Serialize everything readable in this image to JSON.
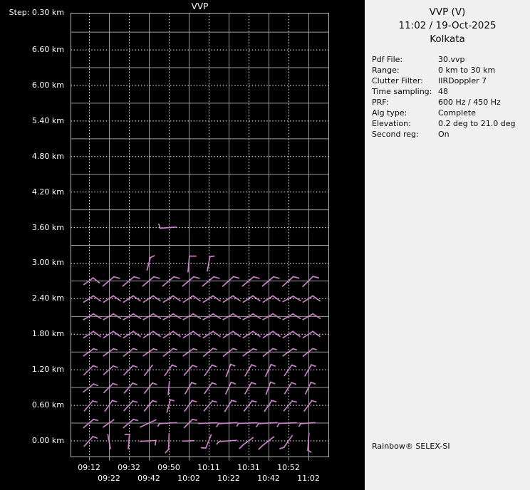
{
  "plot": {
    "title": "VVP",
    "step_label": "Step: 0.30 km",
    "y_ticks": [
      {
        "label": "6.60 km",
        "h": 6.6
      },
      {
        "label": "6.00 km",
        "h": 6.0
      },
      {
        "label": "5.40 km",
        "h": 5.4
      },
      {
        "label": "4.80 km",
        "h": 4.8
      },
      {
        "label": "4.20 km",
        "h": 4.2
      },
      {
        "label": "3.60 km",
        "h": 3.6
      },
      {
        "label": "3.00 km",
        "h": 3.0
      },
      {
        "label": "2.40 km",
        "h": 2.4
      },
      {
        "label": "1.80 km",
        "h": 1.8
      },
      {
        "label": "1.20 km",
        "h": 1.2
      },
      {
        "label": "0.60 km",
        "h": 0.6
      },
      {
        "label": "0.00 km",
        "h": 0.0
      }
    ],
    "x_ticks": [
      {
        "label": "09:12",
        "col": 0,
        "row": 0
      },
      {
        "label": "09:22",
        "col": 1,
        "row": 1
      },
      {
        "label": "09:32",
        "col": 2,
        "row": 0
      },
      {
        "label": "09:42",
        "col": 3,
        "row": 1
      },
      {
        "label": "09:50",
        "col": 4,
        "row": 0
      },
      {
        "label": "10:02",
        "col": 5,
        "row": 1
      },
      {
        "label": "10:11",
        "col": 6,
        "row": 0
      },
      {
        "label": "10:22",
        "col": 7,
        "row": 1
      },
      {
        "label": "10:31",
        "col": 8,
        "row": 0
      },
      {
        "label": "10:42",
        "col": 9,
        "row": 1
      },
      {
        "label": "10:52",
        "col": 10,
        "row": 0
      },
      {
        "label": "11:02",
        "col": 11,
        "row": 1
      }
    ]
  },
  "panel": {
    "title": "VVP (V)",
    "datetime": "11:02 / 19-Oct-2025",
    "site": "Kolkata",
    "params": [
      {
        "label": "Pdf File:",
        "value": "30.vvp"
      },
      {
        "label": "Range:",
        "value": "0 km to 30 km"
      },
      {
        "label": "Clutter Filter:",
        "value": "IIRDoppler 7"
      },
      {
        "label": "Time sampling:",
        "value": "48"
      },
      {
        "label": "PRF:",
        "value": "600 Hz / 450 Hz"
      },
      {
        "label": "Alg type:",
        "value": "Complete"
      },
      {
        "label": "Elevation:",
        "value": "0.2 deg to 21.0 deg"
      },
      {
        "label": "Second reg:",
        "value": "On"
      }
    ],
    "branding": "Rainbow® SELEX-SI"
  },
  "colors": {
    "background": "#000000",
    "panel_bg": "#f0f0f0",
    "panel_text": "#0a0a0a",
    "plot_text": "#ffffff",
    "grid_solid": "#9a9a9a",
    "grid_dotted": "#ffffff",
    "border": "#b2b2b2",
    "barb": "#cb82cb"
  },
  "chart_data": {
    "type": "wind-barb-time-height",
    "title": "VVP",
    "x_times": [
      "09:12",
      "09:22",
      "09:32",
      "09:42",
      "09:50",
      "10:02",
      "10:11",
      "10:22",
      "10:31",
      "10:42",
      "10:52",
      "11:02"
    ],
    "y_height_km": {
      "min": 0.0,
      "max": 7.2,
      "step": 0.3,
      "labeled_every": 0.6
    },
    "grid": {
      "h_dotted_every_km": 0.6,
      "h_solid_every_km": 0.3,
      "v_dotted_cols": "even",
      "v_solid_cols": "odd"
    },
    "legend": "none",
    "barb_note": "each barb = [col,height_km,staff_angle_deg,staff_len_px,kind(p|t|c),tick_angle_deg,tick_len_px,tick_at(tip|base)]",
    "barbs": [
      [
        0,
        0,
        48,
        18,
        "t",
        -20,
        6,
        "tip"
      ],
      [
        1,
        0,
        100,
        20,
        "p",
        0,
        0,
        "tip"
      ],
      [
        2,
        0,
        85,
        20,
        "t",
        180,
        6,
        "tip"
      ],
      [
        3,
        0,
        3,
        22,
        "t",
        -100,
        6,
        "tip"
      ],
      [
        4,
        0,
        88,
        22,
        "t",
        -135,
        6,
        "base"
      ],
      [
        5,
        0,
        2,
        16,
        "p",
        0,
        0,
        "tip"
      ],
      [
        6,
        0,
        68,
        20,
        "t",
        175,
        6,
        "base"
      ],
      [
        7,
        0,
        4,
        24,
        "t",
        -135,
        5,
        "base"
      ],
      [
        8,
        0,
        36,
        17,
        "t",
        -135,
        7,
        "base"
      ],
      [
        9,
        0,
        38,
        20,
        "t",
        -135,
        7,
        "base"
      ],
      [
        10,
        0,
        55,
        20,
        "t",
        -160,
        6,
        "base"
      ],
      [
        11,
        0,
        86,
        24,
        "t",
        -30,
        5,
        "base"
      ],
      [
        0,
        0.3,
        40,
        18,
        "t",
        -15,
        6,
        "tip"
      ],
      [
        1,
        0.3,
        35,
        18,
        "p",
        0,
        0,
        "tip"
      ],
      [
        2,
        0.3,
        40,
        18,
        "t",
        -15,
        6,
        "tip"
      ],
      [
        3,
        0.3,
        25,
        24,
        "p",
        0,
        0,
        "tip"
      ],
      [
        4,
        0.3,
        3,
        24,
        "t",
        -120,
        4,
        "base"
      ],
      [
        5,
        0.3,
        45,
        16,
        "t",
        -10,
        6,
        "tip"
      ],
      [
        6,
        0.3,
        2,
        26,
        "p",
        0,
        0,
        "tip"
      ],
      [
        7,
        0.3,
        3,
        26,
        "t",
        -120,
        5,
        "base"
      ],
      [
        8,
        0.3,
        2,
        26,
        "t",
        -120,
        4,
        "base"
      ],
      [
        9,
        0.3,
        3,
        26,
        "t",
        -120,
        5,
        "base"
      ],
      [
        10,
        0.3,
        2,
        24,
        "t",
        -120,
        5,
        "base"
      ],
      [
        11,
        0.3,
        4,
        20,
        "t",
        -120,
        4,
        "base"
      ],
      [
        0,
        0.6,
        50,
        18,
        "t",
        -15,
        6,
        "tip"
      ],
      [
        1,
        0.6,
        55,
        18,
        "t",
        -15,
        6,
        "tip"
      ],
      [
        2,
        0.6,
        48,
        18,
        "t",
        -15,
        6,
        "tip"
      ],
      [
        3,
        0.6,
        52,
        18,
        "t",
        -15,
        6,
        "tip"
      ],
      [
        4,
        0.6,
        75,
        18,
        "t",
        -15,
        5,
        "tip"
      ],
      [
        5,
        0.6,
        55,
        18,
        "t",
        -15,
        6,
        "tip"
      ],
      [
        6,
        0.6,
        50,
        18,
        "t",
        -15,
        6,
        "tip"
      ],
      [
        7,
        0.6,
        58,
        18,
        "t",
        -15,
        6,
        "tip"
      ],
      [
        8,
        0.6,
        52,
        18,
        "t",
        -15,
        6,
        "tip"
      ],
      [
        9,
        0.6,
        56,
        18,
        "t",
        -15,
        6,
        "tip"
      ],
      [
        10,
        0.6,
        50,
        18,
        "t",
        -15,
        6,
        "tip"
      ],
      [
        11,
        0.6,
        54,
        18,
        "t",
        -15,
        6,
        "tip"
      ],
      [
        0,
        0.9,
        38,
        18,
        "t",
        -20,
        6,
        "tip"
      ],
      [
        1,
        0.9,
        45,
        18,
        "t",
        -20,
        6,
        "tip"
      ],
      [
        2,
        0.9,
        50,
        18,
        "t",
        -20,
        6,
        "tip"
      ],
      [
        3,
        0.9,
        52,
        18,
        "t",
        -20,
        6,
        "tip"
      ],
      [
        4,
        0.9,
        85,
        18,
        "p",
        0,
        0,
        "tip"
      ],
      [
        5,
        0.9,
        60,
        18,
        "t",
        -20,
        6,
        "tip"
      ],
      [
        6,
        0.9,
        55,
        18,
        "t",
        -20,
        6,
        "tip"
      ],
      [
        7,
        0.9,
        65,
        18,
        "t",
        -20,
        6,
        "tip"
      ],
      [
        8,
        0.9,
        60,
        18,
        "t",
        -20,
        6,
        "tip"
      ],
      [
        9,
        0.9,
        70,
        18,
        "t",
        -20,
        6,
        "tip"
      ],
      [
        10,
        0.9,
        58,
        18,
        "t",
        -20,
        6,
        "tip"
      ],
      [
        11,
        0.9,
        65,
        18,
        "t",
        -20,
        6,
        "tip"
      ],
      [
        0,
        1.2,
        45,
        18,
        "t",
        -20,
        6,
        "tip"
      ],
      [
        1,
        1.2,
        42,
        18,
        "t",
        -20,
        6,
        "tip"
      ],
      [
        2,
        1.2,
        46,
        18,
        "t",
        -20,
        6,
        "tip"
      ],
      [
        3,
        1.2,
        52,
        18,
        "p",
        0,
        0,
        "tip"
      ],
      [
        4,
        1.2,
        55,
        18,
        "t",
        -20,
        6,
        "tip"
      ],
      [
        5,
        1.2,
        50,
        18,
        "t",
        -20,
        6,
        "tip"
      ],
      [
        6,
        1.2,
        55,
        18,
        "t",
        -20,
        6,
        "tip"
      ],
      [
        7,
        1.2,
        70,
        18,
        "t",
        -20,
        6,
        "tip"
      ],
      [
        8,
        1.2,
        60,
        18,
        "t",
        -20,
        6,
        "tip"
      ],
      [
        9,
        1.2,
        65,
        18,
        "t",
        -20,
        6,
        "tip"
      ],
      [
        10,
        1.2,
        55,
        18,
        "t",
        -20,
        6,
        "tip"
      ],
      [
        11,
        1.2,
        60,
        18,
        "t",
        -20,
        6,
        "tip"
      ],
      [
        0,
        1.5,
        36,
        17,
        "t",
        -15,
        5,
        "tip"
      ],
      [
        1,
        1.5,
        36,
        17,
        "t",
        -15,
        5,
        "tip"
      ],
      [
        2,
        1.5,
        38,
        17,
        "t",
        -15,
        5,
        "tip"
      ],
      [
        3,
        1.5,
        35,
        17,
        "t",
        -15,
        5,
        "tip"
      ],
      [
        4,
        1.5,
        38,
        17,
        "t",
        -15,
        5,
        "tip"
      ],
      [
        5,
        1.5,
        36,
        17,
        "t",
        -15,
        5,
        "tip"
      ],
      [
        6,
        1.5,
        40,
        17,
        "t",
        -15,
        5,
        "tip"
      ],
      [
        7,
        1.5,
        38,
        17,
        "t",
        -15,
        5,
        "tip"
      ],
      [
        8,
        1.5,
        36,
        17,
        "t",
        -15,
        5,
        "tip"
      ],
      [
        9,
        1.5,
        38,
        17,
        "t",
        -15,
        5,
        "tip"
      ],
      [
        10,
        1.5,
        36,
        17,
        "t",
        -15,
        5,
        "tip"
      ],
      [
        11,
        1.5,
        38,
        17,
        "t",
        -15,
        5,
        "tip"
      ],
      [
        0,
        1.8,
        33,
        16,
        "c",
        -35,
        12,
        "tip"
      ],
      [
        1,
        1.8,
        33,
        16,
        "c",
        -35,
        12,
        "tip"
      ],
      [
        2,
        1.8,
        33,
        16,
        "c",
        -35,
        12,
        "tip"
      ],
      [
        3,
        1.8,
        33,
        16,
        "c",
        -35,
        12,
        "tip"
      ],
      [
        4,
        1.8,
        33,
        16,
        "c",
        -35,
        12,
        "tip"
      ],
      [
        5,
        1.8,
        33,
        16,
        "c",
        -35,
        12,
        "tip"
      ],
      [
        6,
        1.8,
        33,
        16,
        "c",
        -35,
        12,
        "tip"
      ],
      [
        7,
        1.8,
        33,
        16,
        "c",
        -35,
        12,
        "tip"
      ],
      [
        8,
        1.8,
        33,
        16,
        "c",
        -35,
        12,
        "tip"
      ],
      [
        9,
        1.8,
        33,
        16,
        "c",
        -35,
        12,
        "tip"
      ],
      [
        10,
        1.8,
        33,
        16,
        "c",
        -35,
        12,
        "tip"
      ],
      [
        11,
        1.8,
        33,
        16,
        "c",
        -35,
        12,
        "tip"
      ],
      [
        0,
        2.1,
        30,
        16,
        "c",
        -32,
        12,
        "tip"
      ],
      [
        1,
        2.1,
        30,
        16,
        "c",
        -32,
        12,
        "tip"
      ],
      [
        2,
        2.1,
        30,
        16,
        "c",
        -32,
        12,
        "tip"
      ],
      [
        3,
        2.1,
        30,
        16,
        "c",
        -32,
        12,
        "tip"
      ],
      [
        4,
        2.1,
        30,
        16,
        "c",
        -32,
        12,
        "tip"
      ],
      [
        5,
        2.1,
        30,
        16,
        "c",
        -32,
        12,
        "tip"
      ],
      [
        6,
        2.1,
        30,
        16,
        "c",
        -32,
        12,
        "tip"
      ],
      [
        7,
        2.1,
        30,
        16,
        "c",
        -32,
        12,
        "tip"
      ],
      [
        8,
        2.1,
        30,
        16,
        "c",
        -32,
        12,
        "tip"
      ],
      [
        9,
        2.1,
        30,
        16,
        "c",
        -32,
        12,
        "tip"
      ],
      [
        10,
        2.1,
        30,
        16,
        "c",
        -32,
        12,
        "tip"
      ],
      [
        11,
        2.1,
        30,
        16,
        "c",
        -32,
        12,
        "tip"
      ],
      [
        0,
        2.4,
        33,
        16,
        "c",
        -35,
        12,
        "tip"
      ],
      [
        1,
        2.4,
        33,
        16,
        "c",
        -35,
        12,
        "tip"
      ],
      [
        2,
        2.4,
        33,
        16,
        "c",
        -35,
        12,
        "tip"
      ],
      [
        3,
        2.4,
        33,
        16,
        "c",
        -35,
        12,
        "tip"
      ],
      [
        4,
        2.4,
        33,
        16,
        "c",
        -35,
        12,
        "tip"
      ],
      [
        5,
        2.4,
        33,
        16,
        "c",
        -35,
        12,
        "tip"
      ],
      [
        6,
        2.4,
        33,
        16,
        "c",
        -35,
        12,
        "tip"
      ],
      [
        7,
        2.4,
        33,
        16,
        "c",
        -35,
        12,
        "tip"
      ],
      [
        8,
        2.4,
        33,
        16,
        "c",
        -35,
        12,
        "tip"
      ],
      [
        9,
        2.4,
        33,
        16,
        "c",
        -35,
        12,
        "tip"
      ],
      [
        10,
        2.4,
        28,
        16,
        "c",
        -30,
        12,
        "tip"
      ],
      [
        11,
        2.4,
        33,
        16,
        "c",
        -35,
        12,
        "tip"
      ],
      [
        0,
        2.7,
        36,
        16,
        "c",
        -38,
        11,
        "tip"
      ],
      [
        1,
        2.7,
        40,
        20,
        "t",
        -15,
        8,
        "tip"
      ],
      [
        2,
        2.7,
        40,
        20,
        "t",
        -15,
        8,
        "tip"
      ],
      [
        3,
        2.7,
        40,
        20,
        "t",
        -15,
        8,
        "tip"
      ],
      [
        4,
        2.7,
        40,
        20,
        "t",
        -15,
        8,
        "tip"
      ],
      [
        5,
        2.7,
        40,
        20,
        "t",
        -15,
        8,
        "tip"
      ],
      [
        6,
        2.7,
        40,
        20,
        "t",
        -15,
        8,
        "tip"
      ],
      [
        7,
        2.7,
        42,
        20,
        "t",
        -15,
        8,
        "tip"
      ],
      [
        8,
        2.7,
        40,
        20,
        "t",
        -15,
        8,
        "tip"
      ],
      [
        9,
        2.7,
        40,
        20,
        "t",
        -15,
        8,
        "tip"
      ],
      [
        10,
        2.7,
        42,
        20,
        "t",
        -15,
        8,
        "tip"
      ],
      [
        11,
        2.7,
        45,
        20,
        "t",
        -15,
        8,
        "tip"
      ],
      [
        3,
        3.0,
        75,
        18,
        "t",
        25,
        6,
        "tip"
      ],
      [
        5,
        3.0,
        85,
        22,
        "t",
        0,
        9,
        "tip"
      ],
      [
        6,
        3.0,
        80,
        20,
        "t",
        10,
        6,
        "tip"
      ],
      [
        4,
        3.6,
        4,
        22,
        "t",
        110,
        6,
        "base"
      ]
    ]
  }
}
